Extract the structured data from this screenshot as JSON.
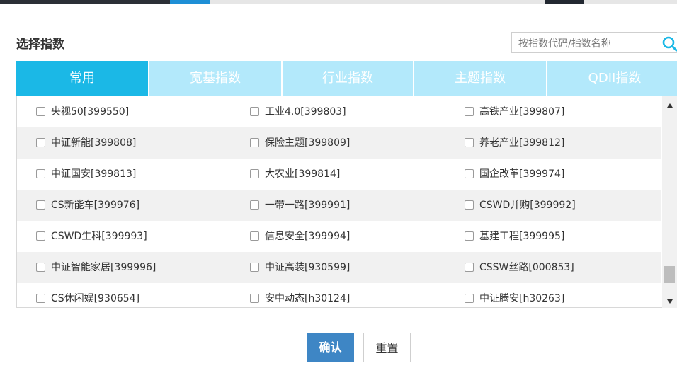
{
  "dialog": {
    "title": "选择指数",
    "search": {
      "placeholder": "按指数代码/指数名称",
      "icon": "search-icon"
    },
    "tabs": [
      {
        "label": "常用",
        "active": true
      },
      {
        "label": "宽基指数",
        "active": false
      },
      {
        "label": "行业指数",
        "active": false
      },
      {
        "label": "主题指数",
        "active": false
      },
      {
        "label": "QDII指数",
        "active": false
      }
    ],
    "items": [
      [
        "央视50[399550]",
        "工业4.0[399803]",
        "高铁产业[399807]"
      ],
      [
        "中证新能[399808]",
        "保险主题[399809]",
        "养老产业[399812]"
      ],
      [
        "中证国安[399813]",
        "大农业[399814]",
        "国企改革[399974]"
      ],
      [
        "CS新能车[399976]",
        "一带一路[399991]",
        "CSWD并购[399992]"
      ],
      [
        "CSWD生科[399993]",
        "信息安全[399994]",
        "基建工程[399995]"
      ],
      [
        "中证智能家居[399996]",
        "中证高装[930599]",
        "CSSW丝路[000853]"
      ],
      [
        "CS休闲娱[930654]",
        "安中动态[h30124]",
        "中证腾安[h30263]"
      ]
    ],
    "buttons": {
      "confirm": "确认",
      "reset": "重置"
    },
    "colors": {
      "tab_active": "#1bb8e6",
      "tab_inactive": "#b3e9fb",
      "confirm_button": "#3e86c5",
      "search_icon": "#1bb8e6"
    }
  }
}
